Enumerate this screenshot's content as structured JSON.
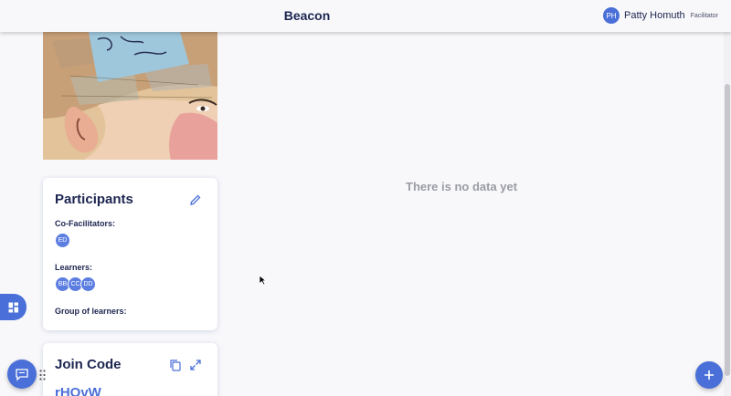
{
  "header": {
    "app_title": "Beacon",
    "user": {
      "initials": "PH",
      "name": "Patty Homuth",
      "role": "Facilitator"
    }
  },
  "participants": {
    "title": "Participants",
    "co_facilitators_label": "Co-Facilitators:",
    "co_facilitators": [
      "ED"
    ],
    "learners_label": "Learners:",
    "learners": [
      "BB",
      "CC",
      "DD"
    ],
    "group_label": "Group of learners:"
  },
  "join_code": {
    "title": "Join Code",
    "code": "rHOvW"
  },
  "main": {
    "empty_message": "There is no data yet"
  },
  "colors": {
    "accent": "#4a6fd8",
    "text_dark": "#1c2550",
    "muted": "#9a9ca4"
  },
  "icons": [
    "edit-icon",
    "copy-icon",
    "expand-icon",
    "dashboard-icon",
    "chat-icon",
    "drag-handle-icon",
    "plus-icon",
    "cursor-icon"
  ]
}
